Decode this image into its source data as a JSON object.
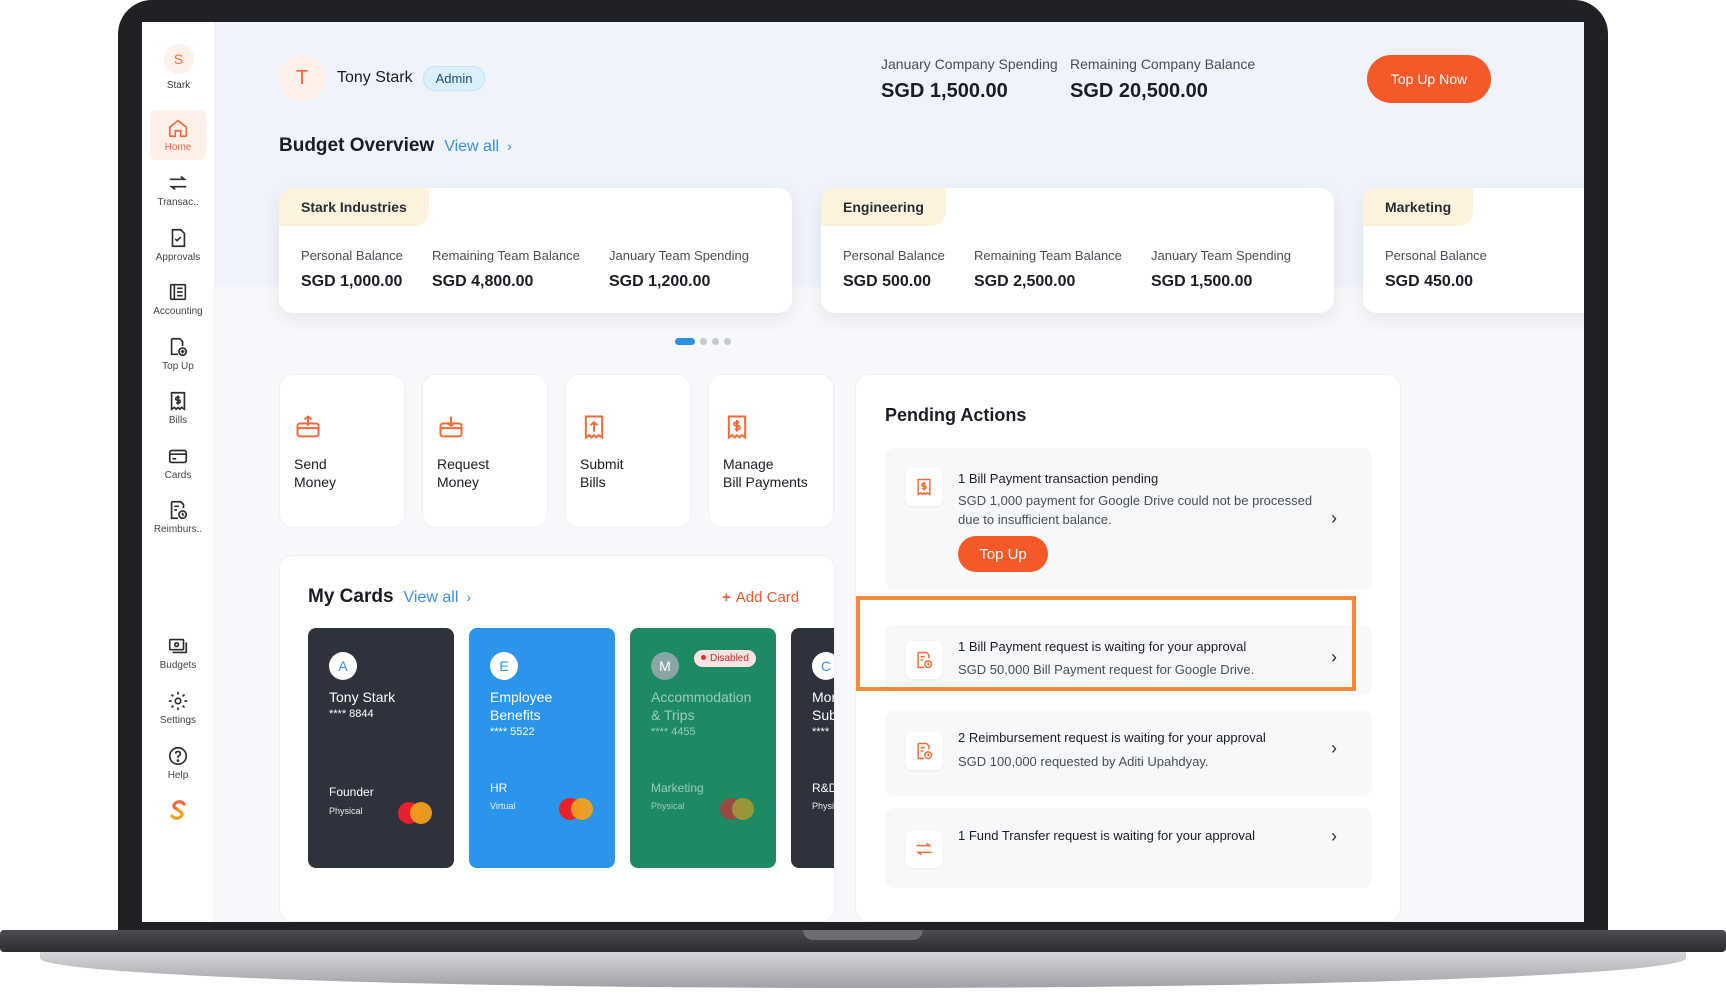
{
  "org": {
    "initial": "S",
    "name": "Stark"
  },
  "nav": [
    {
      "label": "Home",
      "icon": "home-icon"
    },
    {
      "label": "Transac..",
      "icon": "transfer-arrows-icon"
    },
    {
      "label": "Approvals",
      "icon": "approval-document-icon"
    },
    {
      "label": "Accounting",
      "icon": "accounting-ledger-icon"
    },
    {
      "label": "Top Up",
      "icon": "top-up-icon"
    },
    {
      "label": "Bills",
      "icon": "bill-dollar-icon"
    },
    {
      "label": "Cards",
      "icon": "credit-card-icon"
    },
    {
      "label": "Reimburs..",
      "icon": "reimbursement-icon"
    }
  ],
  "nav_bottom": [
    {
      "label": "Budgets",
      "icon": "budgets-icon"
    },
    {
      "label": "Settings",
      "icon": "gear-icon"
    },
    {
      "label": "Help",
      "icon": "help-circle-icon"
    }
  ],
  "user": {
    "initial": "T",
    "name": "Tony Stark",
    "role": "Admin"
  },
  "stats": {
    "spending_label": "January Company Spending",
    "spending_value": "SGD 1,500.00",
    "balance_label": "Remaining Company Balance",
    "balance_value": "SGD 20,500.00",
    "top_up_label": "Top Up Now"
  },
  "budget_overview": {
    "title": "Budget Overview",
    "view_all": "View all",
    "budgets": [
      {
        "name": "Stark Industries",
        "cols": [
          {
            "label": "Personal Balance",
            "value": "SGD 1,000.00"
          },
          {
            "label": "Remaining Team Balance",
            "value": "SGD 4,800.00"
          },
          {
            "label": "January Team Spending",
            "value": "SGD 1,200.00"
          }
        ]
      },
      {
        "name": "Engineering",
        "cols": [
          {
            "label": "Personal Balance",
            "value": "SGD 500.00"
          },
          {
            "label": "Remaining Team Balance",
            "value": "SGD 2,500.00"
          },
          {
            "label": "January Team Spending",
            "value": "SGD 1,500.00"
          }
        ]
      },
      {
        "name": "Marketing",
        "cols": [
          {
            "label": "Personal Balance",
            "value": "SGD 450.00"
          }
        ]
      }
    ],
    "page_count": 4,
    "active_page": 1
  },
  "quick_actions": [
    {
      "label": "Send\nMoney",
      "icon": "send-money-icon"
    },
    {
      "label": "Request\nMoney",
      "icon": "request-money-icon"
    },
    {
      "label": "Submit\nBills",
      "icon": "submit-bills-icon"
    },
    {
      "label": "Manage\nBill Payments",
      "icon": "manage-bill-payments-icon"
    }
  ],
  "my_cards": {
    "title": "My Cards",
    "view_all": "View all",
    "add_card": "Add Card",
    "cards": [
      {
        "initial": "A",
        "name": "Tony Stark",
        "number": "**** 8844",
        "team": "Founder",
        "type": "Physical",
        "color": "#2e323d",
        "initial_color": "#3d8fe0"
      },
      {
        "initial": "E",
        "name": "Employee\nBenefits",
        "number": "**** 5522",
        "team": "HR",
        "type": "Virtual",
        "color": "#2a95ea",
        "initial_color": "#2a95ea"
      },
      {
        "initial": "M",
        "name": "Accommodation\n& Trips",
        "number": "**** 4455",
        "team": "Marketing",
        "type": "Physical",
        "color": "#1e8a64",
        "initial_color": "#ffffff",
        "badge": "Disabled"
      },
      {
        "initial": "C",
        "name": "Mor\nSub",
        "number": "****",
        "team": "R&D",
        "type": "Physi",
        "color": "#2e323d",
        "initial_color": "#3d8fe0"
      }
    ]
  },
  "pending": {
    "title": "Pending Actions",
    "items": [
      {
        "title": "1 Bill Payment transaction pending",
        "desc": "SGD 1,000 payment for Google Drive could not be processed due to insufficient balance.",
        "button": "Top Up",
        "icon": "bill-dollar-icon"
      },
      {
        "title": "1 Bill Payment request is waiting for your approval",
        "desc": "SGD 50,000 Bill Payment request for Google Drive.",
        "icon": "bill-clock-icon"
      },
      {
        "title": "2 Reimbursement request is waiting for your approval",
        "desc": "SGD 100,000 requested by Aditi Upahdyay.",
        "icon": "reimbursement-clock-icon"
      },
      {
        "title": "1 Fund Transfer request is waiting for your approval",
        "desc": "",
        "icon": "fund-transfer-icon"
      }
    ]
  },
  "colors": {
    "accent": "#f4592a",
    "link": "#3d8fe0",
    "highlight": "#f28a3c"
  }
}
